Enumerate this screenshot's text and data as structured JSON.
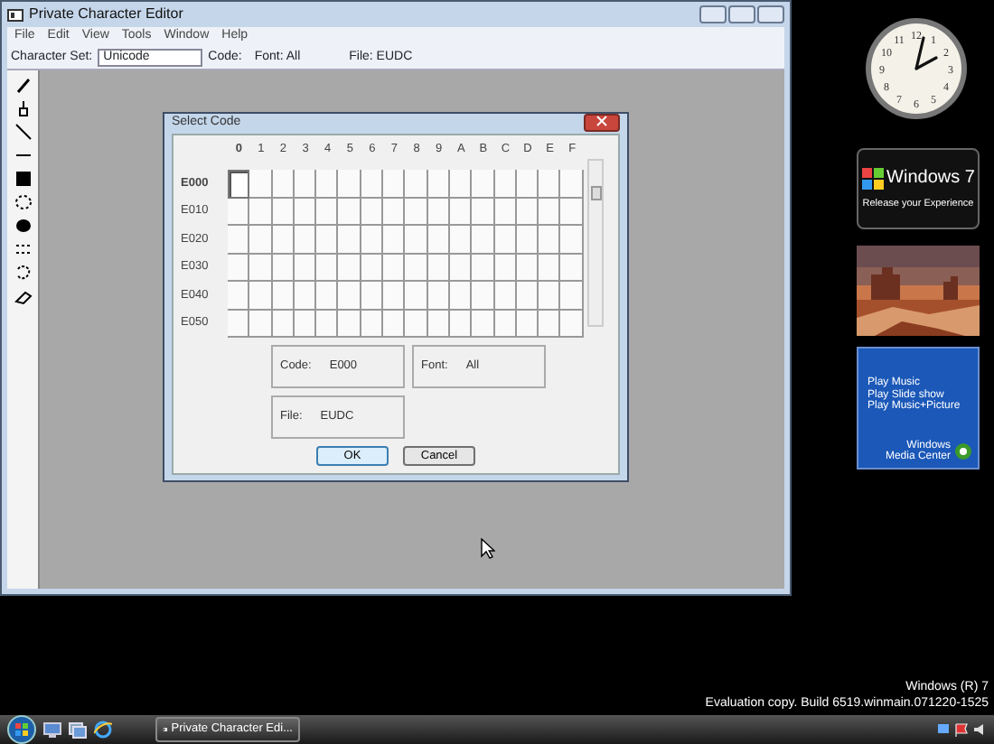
{
  "main_window": {
    "title": "Private Character Editor",
    "menu": [
      "File",
      "Edit",
      "View",
      "Tools",
      "Window",
      "Help"
    ],
    "toolbar": {
      "character_set_label": "Character Set:",
      "character_set": "Unicode",
      "code_label": "Code:",
      "font": "Font: All",
      "file": "File: EUDC"
    }
  },
  "dialog": {
    "title": "Select Code",
    "columns": [
      {
        "label": "0",
        "selected": true
      },
      {
        "label": "1",
        "selected": false
      },
      {
        "label": "2",
        "selected": false
      },
      {
        "label": "3",
        "selected": false
      },
      {
        "label": "4",
        "selected": false
      },
      {
        "label": "5",
        "selected": false
      },
      {
        "label": "6",
        "selected": false
      },
      {
        "label": "7",
        "selected": false
      },
      {
        "label": "8",
        "selected": false
      },
      {
        "label": "9",
        "selected": false
      },
      {
        "label": "A",
        "selected": false
      },
      {
        "label": "B",
        "selected": false
      },
      {
        "label": "C",
        "selected": false
      },
      {
        "label": "D",
        "selected": false
      },
      {
        "label": "E",
        "selected": false
      },
      {
        "label": "F",
        "selected": false
      }
    ],
    "rows": [
      {
        "label": "E000",
        "selected": true
      },
      {
        "label": "E010",
        "selected": false
      },
      {
        "label": "E020",
        "selected": false
      },
      {
        "label": "E030",
        "selected": false
      },
      {
        "label": "E040",
        "selected": false
      },
      {
        "label": "E050",
        "selected": false
      }
    ],
    "code_label": "Code:",
    "code": "E000",
    "font_label": "Font:",
    "font": "All",
    "file_label": "File:",
    "file": "EUDC",
    "buttons": [
      "OK",
      "Cancel"
    ]
  },
  "gadgets": {
    "clock_numerals": [
      "12",
      "1",
      "2",
      "3",
      "4",
      "5",
      "6",
      "7",
      "8",
      "9",
      "10",
      "11"
    ],
    "windows7": {
      "title": "Windows 7",
      "tagline": "Release your Experience"
    },
    "media_center": {
      "links": [
        "Play Music",
        "Play Slide show",
        "Play Music+Picture"
      ],
      "brand": [
        "Windows",
        "Media Center"
      ]
    }
  },
  "desktop_watermark": [
    "Windows (R) 7",
    "Evaluation copy. Build 6519.winmain.071220-1525"
  ],
  "taskbar": {
    "tasks": [
      "Private Character Edi..."
    ]
  }
}
